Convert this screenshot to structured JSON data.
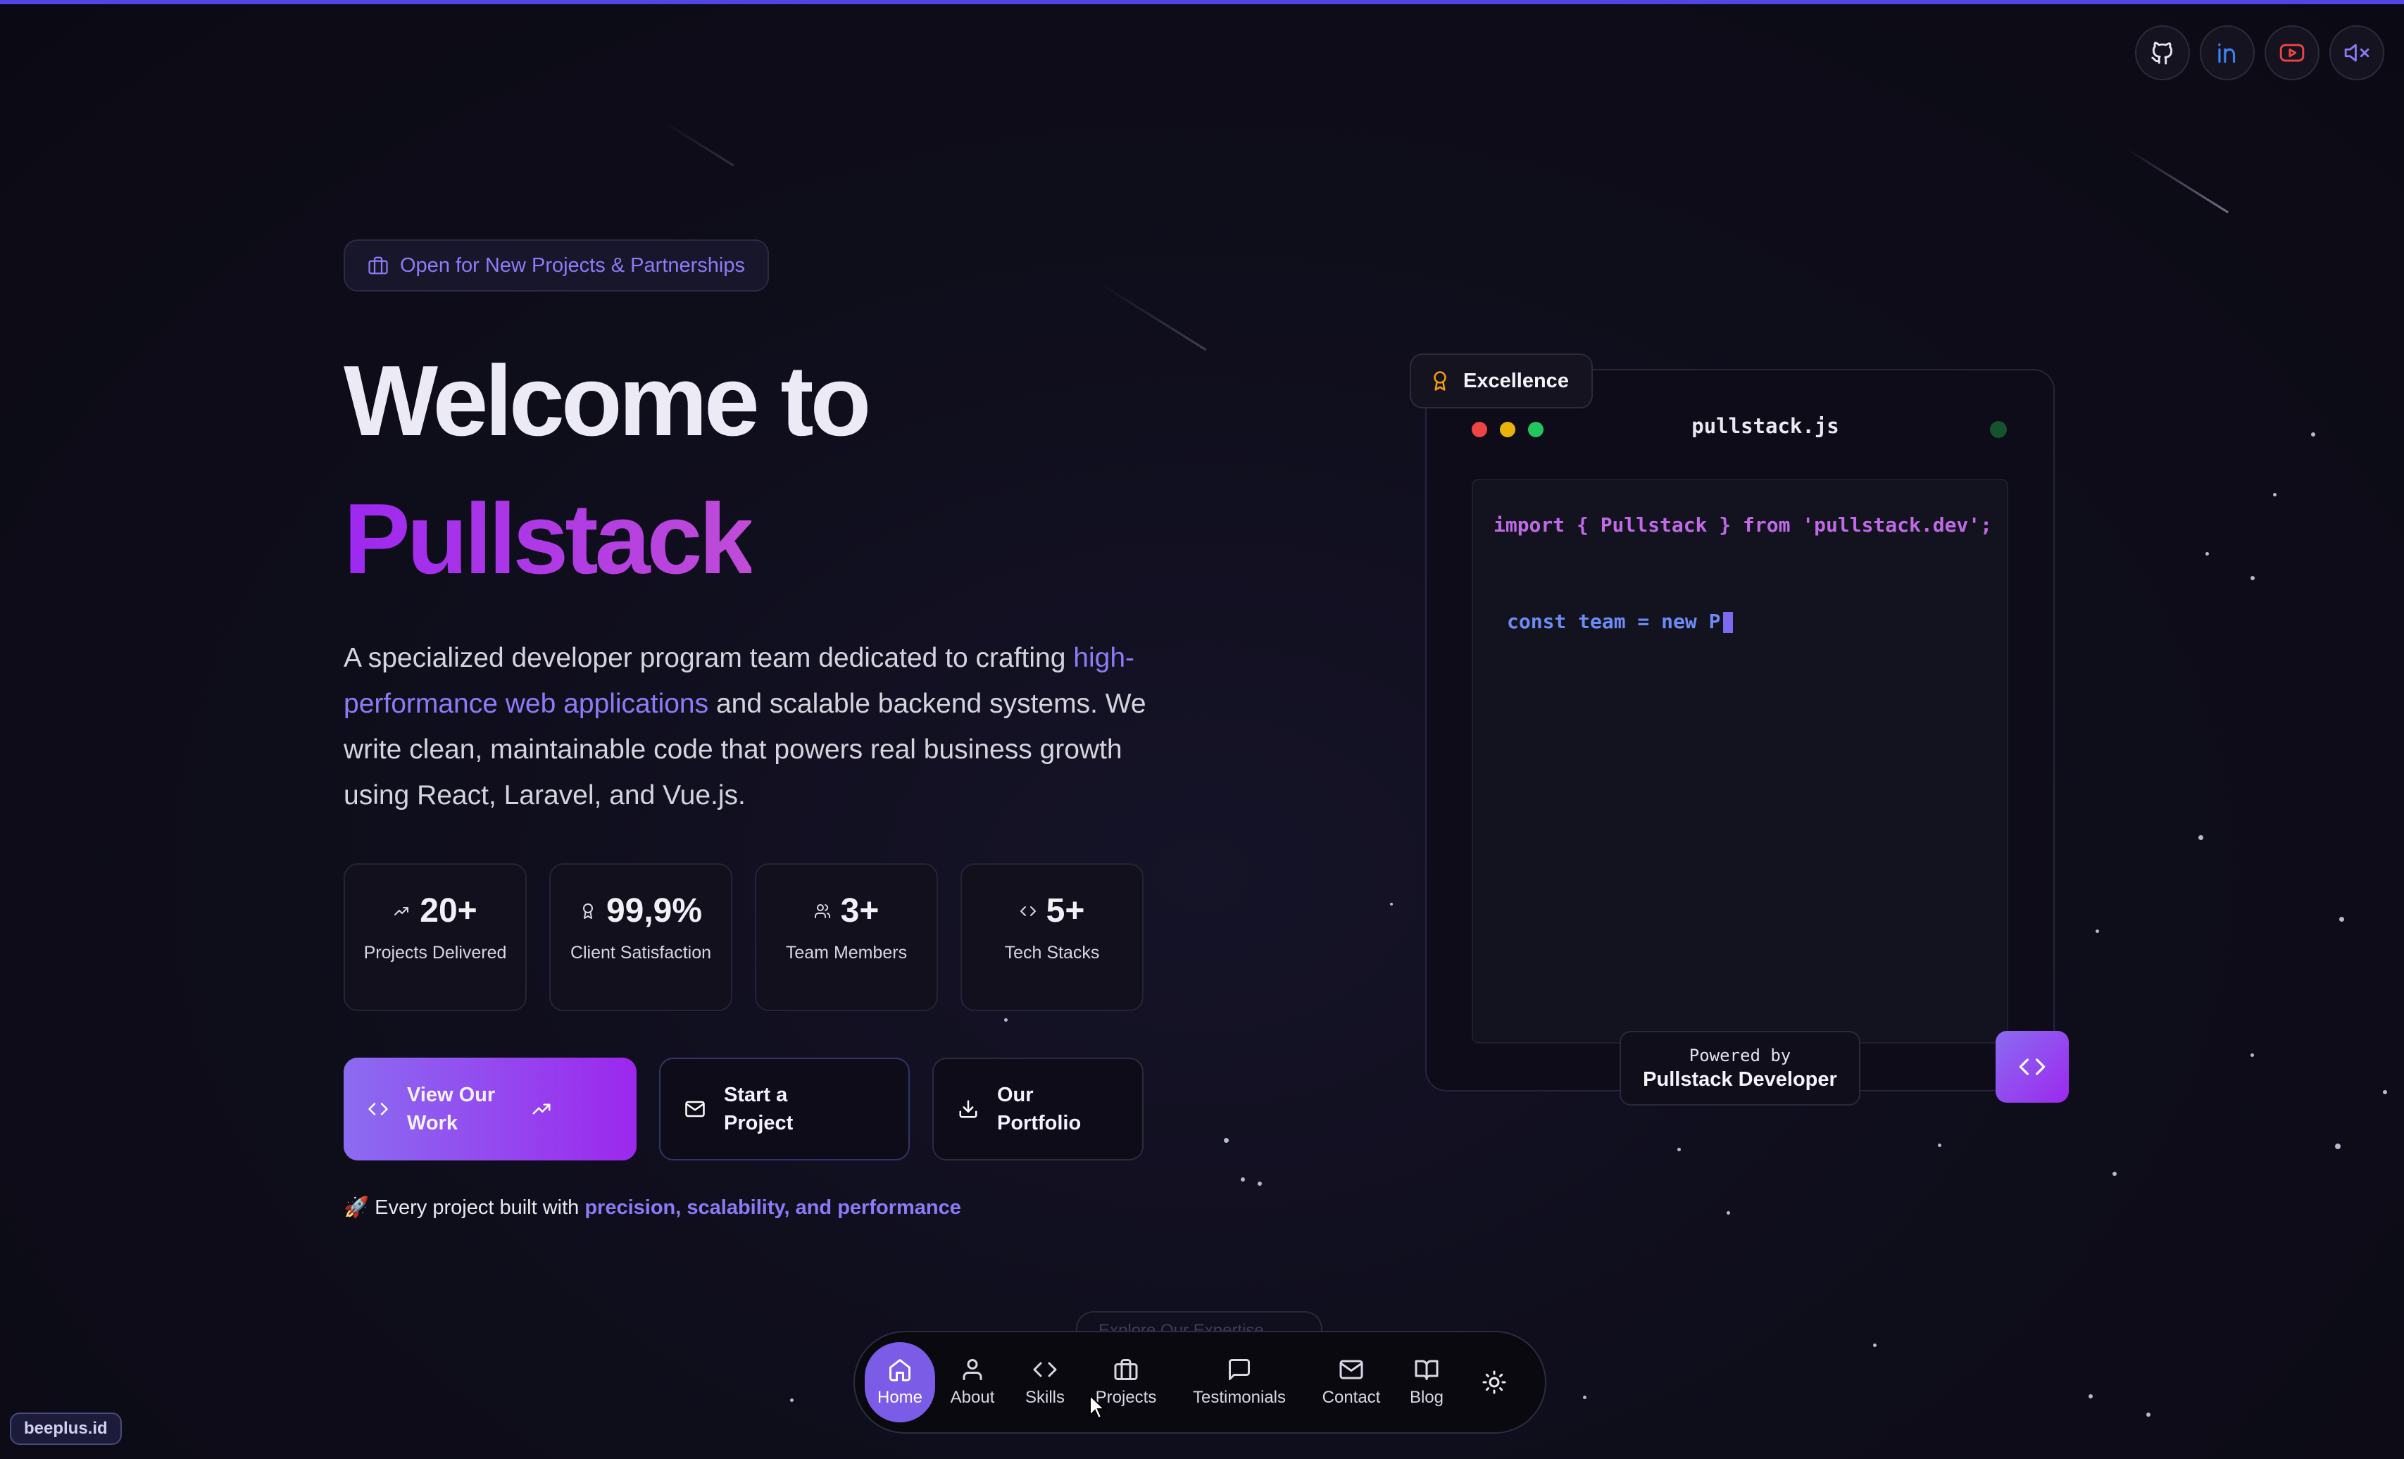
{
  "badge": {
    "label": "Open for New Projects & Partnerships",
    "icon": "briefcase-icon"
  },
  "hero": {
    "title_line1": "Welcome to",
    "title_line2": "Pullstack",
    "desc_part1": "A specialized developer program team dedicated to crafting",
    "desc_highlight": "high-performance web applications",
    "desc_part2": "and scalable backend systems. We write clean, maintainable code that powers real business growth using React, Laravel, and Vue.js."
  },
  "stats": [
    {
      "icon": "trending-up-icon",
      "value": "20+",
      "label": "Projects Delivered"
    },
    {
      "icon": "award-icon",
      "value": "99,9%",
      "label": "Client Satisfaction"
    },
    {
      "icon": "users-icon",
      "value": "3+",
      "label": "Team Members"
    },
    {
      "icon": "code-icon",
      "value": "5+",
      "label": "Tech Stacks"
    }
  ],
  "buttons": {
    "view_work": "View Our Work",
    "start_project": "Start a Project",
    "portfolio": "Our Portfolio"
  },
  "footnote": {
    "prefix": "🚀 Every project built with",
    "highlight": "precision, scalability, and performance"
  },
  "code_window": {
    "badge": "Excellence",
    "filename": "pullstack.js",
    "import_line": "import { Pullstack } from 'pullstack.dev';",
    "typing_line": "const team = new P",
    "powered_by": "Powered by",
    "powered_name": "Pullstack Developer"
  },
  "nav": {
    "items": [
      {
        "label": "Home",
        "icon": "home-icon",
        "active": true
      },
      {
        "label": "About",
        "icon": "user-icon"
      },
      {
        "label": "Skills",
        "icon": "code-icon"
      },
      {
        "label": "Projects",
        "icon": "briefcase-icon"
      },
      {
        "label": "Testimonials",
        "icon": "message-icon"
      },
      {
        "label": "Contact",
        "icon": "mail-icon"
      },
      {
        "label": "Blog",
        "icon": "book-icon"
      }
    ],
    "theme_icon": "sun-icon",
    "ghost_text": "Explore Our Expertise"
  },
  "socials": [
    "github-icon",
    "linkedin-icon",
    "youtube-icon",
    "mute-icon"
  ],
  "watermark": "beeplus.id",
  "colors": {
    "accent": "#8b7cf6",
    "gradient_start": "#8b6cf0",
    "gradient_end": "#9c28ee",
    "topbar": "#4f46e5"
  }
}
